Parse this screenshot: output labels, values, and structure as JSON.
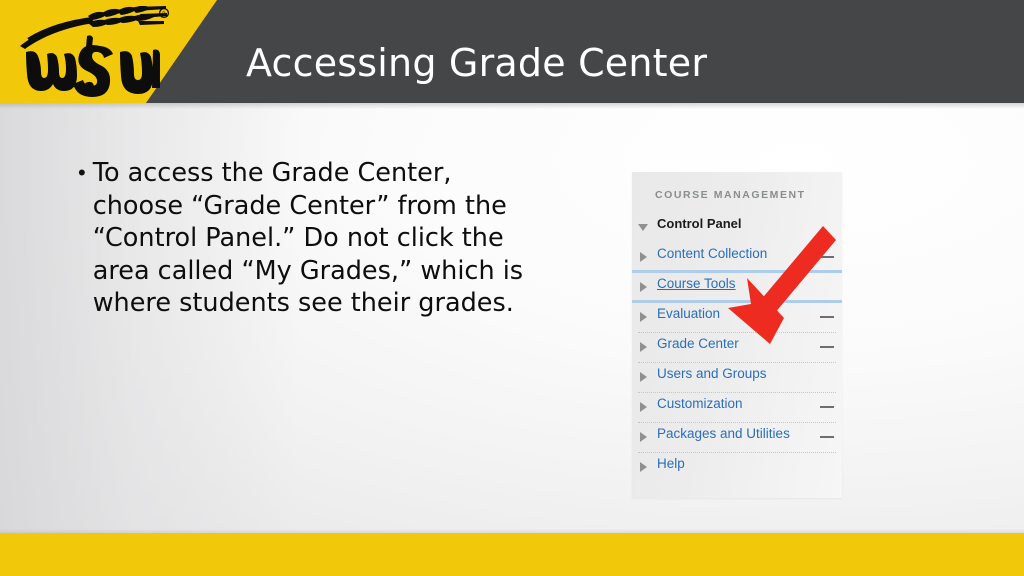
{
  "slide": {
    "title": "Accessing Grade Center",
    "body_bullet": "To access the Grade Center, choose “Grade Center” from the “Control Panel.”  Do not click the area called “My Grades,” which is where students see their grades.",
    "bullet_marker": "•"
  },
  "brand": {
    "logo_name": "wsu-wheatshocker-logo",
    "logo_text": "WSU",
    "yellow": "#F2C80A",
    "header_gray": "#454648",
    "title_color": "#FFFFFF"
  },
  "screenshot_panel": {
    "heading": "COURSE MANAGEMENT",
    "link_color": "#2A6EBB",
    "items": [
      {
        "label": "Control Panel",
        "style": "header",
        "marker": "down-triangle",
        "dash": false,
        "underline": false,
        "sep_below": "none"
      },
      {
        "label": "Content Collection",
        "style": "link",
        "marker": "right-triangle",
        "dash": true,
        "underline": false,
        "sep_below": "blue"
      },
      {
        "label": "Course Tools",
        "style": "link",
        "marker": "right-triangle",
        "dash": false,
        "underline": true,
        "sep_below": "blue"
      },
      {
        "label": "Evaluation",
        "style": "link",
        "marker": "right-triangle",
        "dash": true,
        "underline": false,
        "sep_below": "dotted"
      },
      {
        "label": "Grade Center",
        "style": "link",
        "marker": "right-triangle",
        "dash": true,
        "underline": false,
        "sep_below": "dotted"
      },
      {
        "label": "Users and Groups",
        "style": "link",
        "marker": "right-triangle",
        "dash": false,
        "underline": false,
        "sep_below": "dotted"
      },
      {
        "label": "Customization",
        "style": "link",
        "marker": "right-triangle",
        "dash": true,
        "underline": false,
        "sep_below": "dotted"
      },
      {
        "label": "Packages and Utilities",
        "style": "link",
        "marker": "right-triangle",
        "dash": true,
        "underline": false,
        "sep_below": "dotted"
      },
      {
        "label": "Help",
        "style": "link",
        "marker": "right-triangle",
        "dash": false,
        "underline": false,
        "sep_below": "none"
      }
    ]
  },
  "annotation": {
    "arrow_name": "red-arrow-pointing-to-grade-center",
    "arrow_color": "#EE2B20",
    "points_to": "Grade Center"
  }
}
